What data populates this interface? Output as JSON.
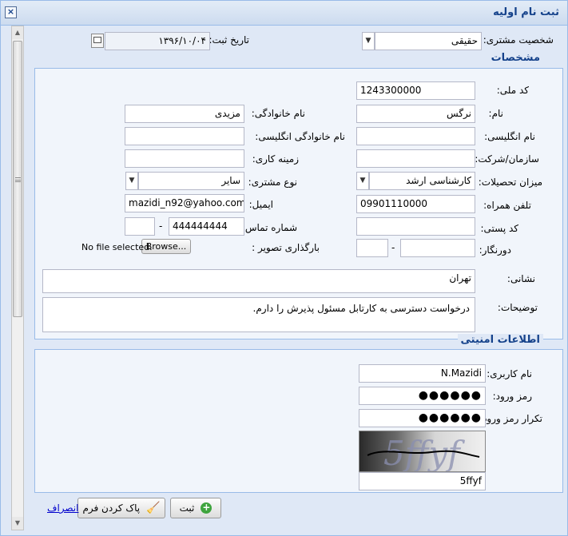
{
  "window": {
    "title": "ثبت نام اولیه",
    "close": "×"
  },
  "top": {
    "customer_type_label": "شخصیت مشتری:",
    "customer_type_value": "حقیقی",
    "reg_date_label": "تاریخ ثبت:",
    "reg_date_value": "۱۳۹۶/۱۰/۰۴"
  },
  "details": {
    "legend": "مشخصات",
    "national_code_label": "کد ملی:",
    "national_code_value": "1243300000",
    "first_name_label": "نام:",
    "first_name_value": "نرگس",
    "last_name_label": "نام خانوادگی:",
    "last_name_value": "مزیدی",
    "en_first_name_label": "نام انگلیسی:",
    "en_first_name_value": "",
    "en_last_name_label": "نام خانوادگی انگلیسی:",
    "en_last_name_value": "",
    "org_label": "سازمان/شرکت:",
    "org_value": "",
    "field_label": "زمینه کاری:",
    "field_value": "",
    "education_label": "میزان تحصیلات:",
    "education_value": "کارشناسی ارشد",
    "customer_kind_label": "نوع مشتری:",
    "customer_kind_value": "سایر",
    "mobile_label": "تلفن همراه:",
    "mobile_value": "09901110000",
    "email_label": "ایمیل:",
    "email_value": "mazidi_n92@yahoo.com",
    "postal_label": "کد پستی:",
    "postal_value": "",
    "phone_label": "شماره تماس:",
    "phone_value": "444444444",
    "phone_code_value": "",
    "fax_label": "دورنگار:",
    "fax_value": "",
    "fax_code_value": "",
    "dash": "-",
    "image_label": "بارگذاری تصویر :",
    "browse_label": "Browse...",
    "no_file_text": "No file selected.",
    "address_label": "نشانی:",
    "address_value": "تهران",
    "desc_label": "توضیحات:",
    "desc_value": "درخواست دسترسی به کارتابل مسئول پذیرش را دارم."
  },
  "security": {
    "legend": "اطلاعات امنیتی",
    "username_label": "نام کاربری:",
    "username_value": "N.Mazidi",
    "password_label": "رمز ورود:",
    "password_value": "●●●●●●",
    "confirm_label": "تکرار رمز ورود:",
    "confirm_value": "●●●●●●",
    "captcha_value": "5ffyf"
  },
  "buttons": {
    "submit_label": "ثبت",
    "clear_label": "پاک کردن فرم",
    "cancel_label": "انصراف"
  },
  "colors": {
    "header_text": "#15428b",
    "border": "#99bbe8",
    "panel": "#dfe8f6"
  }
}
